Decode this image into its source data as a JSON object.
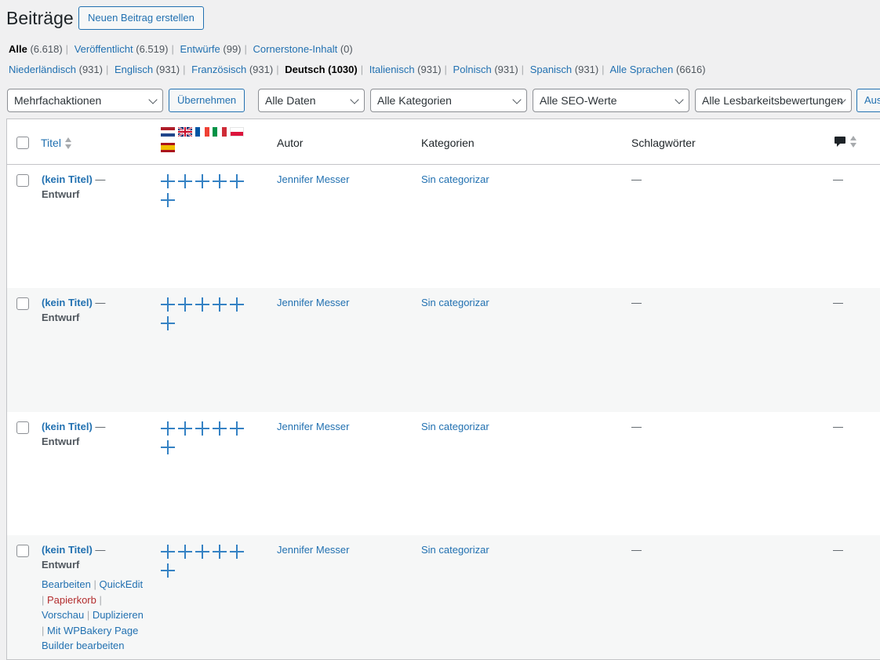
{
  "header": {
    "title": "Beiträge",
    "add_new": "Neuen Beitrag erstellen"
  },
  "status_links": [
    {
      "label": "Alle",
      "count": "(6.618)",
      "current": true
    },
    {
      "label": "Veröffentlicht",
      "count": "(6.519)"
    },
    {
      "label": "Entwürfe",
      "count": "(99)"
    },
    {
      "label": "Cornerstone-Inhalt",
      "count": "(0)"
    }
  ],
  "language_links": [
    {
      "label": "Niederländisch",
      "count": "(931)"
    },
    {
      "label": "Englisch",
      "count": "(931)"
    },
    {
      "label": "Französisch",
      "count": "(931)"
    },
    {
      "label": "Deutsch",
      "count": "(1030)",
      "current": true
    },
    {
      "label": "Italienisch",
      "count": "(931)"
    },
    {
      "label": "Polnisch",
      "count": "(931)"
    },
    {
      "label": "Spanisch",
      "count": "(931)"
    },
    {
      "label": "Alle Sprachen",
      "count": "(6616)"
    }
  ],
  "filters": {
    "bulk_actions": "Mehrfachaktionen",
    "apply": "Übernehmen",
    "dates": "Alle Daten",
    "categories": "Alle Kategorien",
    "seo": "Alle SEO-Werte",
    "readability": "Alle Lesbarkeitsbewertungen",
    "filter_button": "Auswahl einschränken"
  },
  "columns": {
    "title": "Titel",
    "author": "Autor",
    "categories": "Kategorien",
    "tags": "Schlagwörter"
  },
  "flags": [
    "nl",
    "gb",
    "fr",
    "it",
    "pl",
    "es"
  ],
  "icons": {
    "comments": "comment-bubble-icon",
    "add_translation": "plus-icon"
  },
  "rows": [
    {
      "title": "(kein Titel)",
      "dash": "—",
      "state": "Entwurf",
      "author": "Jennifer Messer",
      "category": "Sin categorizar",
      "tags": "—",
      "comments": "—"
    },
    {
      "title": "(kein Titel)",
      "dash": "—",
      "state": "Entwurf",
      "author": "Jennifer Messer",
      "category": "Sin categorizar",
      "tags": "—",
      "comments": "—"
    },
    {
      "title": "(kein Titel)",
      "dash": "—",
      "state": "Entwurf",
      "author": "Jennifer Messer",
      "category": "Sin categorizar",
      "tags": "—",
      "comments": "—"
    },
    {
      "title": "(kein Titel)",
      "dash": "—",
      "state": "Entwurf",
      "author": "Jennifer Messer",
      "category": "Sin categorizar",
      "tags": "—",
      "comments": "—"
    }
  ],
  "row_actions": {
    "edit": "Bearbeiten",
    "quickedit": "QuickEdit",
    "trash": "Papierkorb",
    "preview": "Vorschau",
    "duplicate": "Duplizieren",
    "wpbakery": "Mit WPBakery Page Builder bearbeiten"
  },
  "colors": {
    "link": "#2271b1",
    "trash": "#b32d2e",
    "background": "#f0f0f1",
    "row_alt": "#f6f7f7"
  }
}
